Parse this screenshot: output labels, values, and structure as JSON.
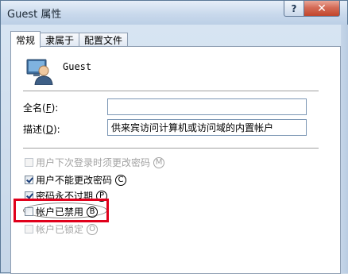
{
  "window": {
    "title": "Guest 属性",
    "help_label": "?",
    "close_label": "✕"
  },
  "tabs": [
    {
      "label": "常规",
      "active": true
    },
    {
      "label": "隶属于",
      "active": false
    },
    {
      "label": "配置文件",
      "active": false
    }
  ],
  "user": {
    "name": "Guest",
    "icon": "user-account-icon"
  },
  "form": {
    "fullname": {
      "label": "全名",
      "hotkey": "F",
      "value": ""
    },
    "description": {
      "label": "描述",
      "hotkey": "D",
      "value": "供来宾访问计算机或访问域的内置帐户"
    }
  },
  "checkboxes": [
    {
      "label": "用户下次登录时须更改密码",
      "hotkey": "M",
      "checked": false,
      "disabled": true
    },
    {
      "label": "用户不能更改密码",
      "hotkey": "C",
      "checked": true,
      "disabled": false
    },
    {
      "label": "密码永不过期",
      "hotkey": "P",
      "checked": true,
      "disabled": false
    },
    {
      "label": "帐户已禁用",
      "hotkey": "B",
      "checked": false,
      "disabled": false
    },
    {
      "label": "帐户已锁定",
      "hotkey": "O",
      "checked": false,
      "disabled": true
    }
  ],
  "colors": {
    "highlight": "#e0001b",
    "close_button": "#c1452c"
  }
}
